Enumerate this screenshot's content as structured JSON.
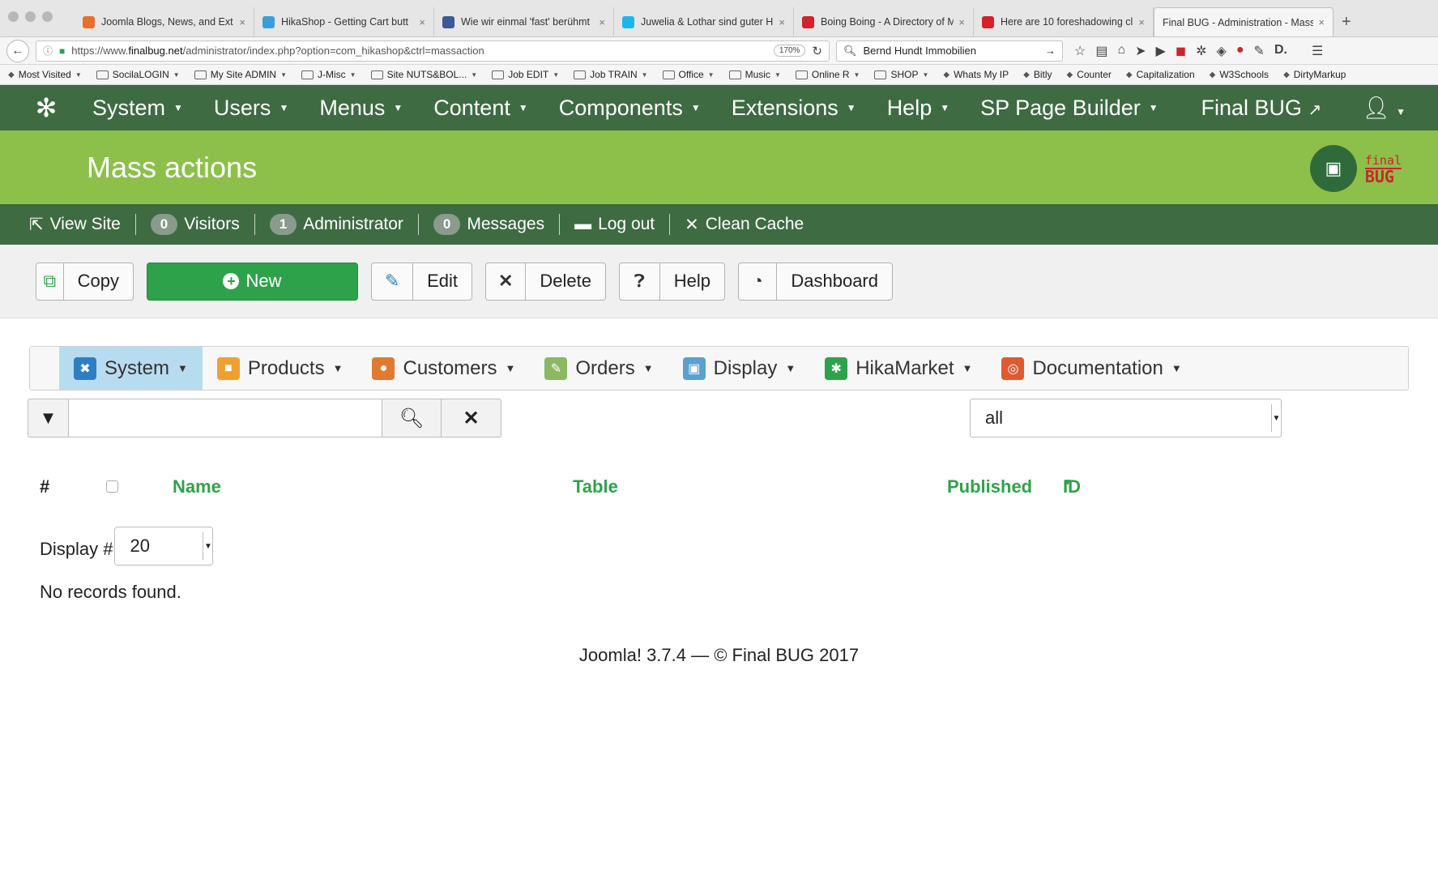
{
  "browser": {
    "tabs": [
      {
        "title": "Joomla Blogs, News, and Ext",
        "color": "#e8702a"
      },
      {
        "title": "HikaShop - Getting Cart butt",
        "color": "#3a9fd8"
      },
      {
        "title": "Wie wir einmal 'fast' berühmt",
        "color": "#3b5998"
      },
      {
        "title": "Juwelia & Lothar sind guter H",
        "color": "#1ab7ea"
      },
      {
        "title": "Boing Boing - A Directory of M",
        "color": "#d4212b"
      },
      {
        "title": "Here are 10 foreshadowing cl",
        "color": "#d4212b"
      },
      {
        "title": "Final BUG - Administration - Mass",
        "color": "#ffffff",
        "active": true
      }
    ],
    "new_tab": "+",
    "url_prefix": "https://www.",
    "url_domain": "finalbug.net",
    "url_rest": "/administrator/index.php?option=com_hikashop&ctrl=massaction",
    "zoom": "170%",
    "search_value": "Bernd Hundt Immobilien",
    "bookmarks": [
      {
        "label": "Most Visited",
        "folder": false,
        "caret": true
      },
      {
        "label": "SocilaLOGIN",
        "folder": true,
        "caret": true
      },
      {
        "label": "My Site ADMIN",
        "folder": true,
        "caret": true
      },
      {
        "label": "J-Misc",
        "folder": true,
        "caret": true
      },
      {
        "label": "Site NUTS&BOL...",
        "folder": true,
        "caret": true
      },
      {
        "label": "Job EDIT",
        "folder": true,
        "caret": true
      },
      {
        "label": "Job TRAIN",
        "folder": true,
        "caret": true
      },
      {
        "label": "Office",
        "folder": true,
        "caret": true
      },
      {
        "label": "Music",
        "folder": true,
        "caret": true
      },
      {
        "label": "Online R",
        "folder": true,
        "caret": true
      },
      {
        "label": "SHOP",
        "folder": true,
        "caret": true
      },
      {
        "label": "Whats My IP",
        "folder": false,
        "caret": false
      },
      {
        "label": "Bitly",
        "folder": false,
        "caret": false
      },
      {
        "label": "Counter",
        "folder": false,
        "caret": false
      },
      {
        "label": "Capitalization",
        "folder": false,
        "caret": false
      },
      {
        "label": "W3Schools",
        "folder": false,
        "caret": false
      },
      {
        "label": "DirtyMarkup",
        "folder": false,
        "caret": false
      }
    ]
  },
  "joomla": {
    "menu": [
      "System",
      "Users",
      "Menus",
      "Content",
      "Components",
      "Extensions",
      "Help",
      "SP Page Builder"
    ],
    "site_link": "Final BUG",
    "page_title": "Mass actions",
    "brand_small": "final",
    "brand_big": "BUG",
    "status": {
      "view_site": "View Site",
      "visitors_count": "0",
      "visitors_label": "Visitors",
      "admin_count": "1",
      "admin_label": "Administrator",
      "messages_count": "0",
      "messages_label": "Messages",
      "logout": "Log out",
      "clean_cache": "Clean Cache"
    },
    "toolbar": {
      "copy": "Copy",
      "new": "New",
      "edit": "Edit",
      "delete": "Delete",
      "help": "Help",
      "dashboard": "Dashboard"
    }
  },
  "hikashop": {
    "menu": [
      {
        "label": "System",
        "icon": "wrench-icon",
        "color": "#2e7fc2",
        "active": true
      },
      {
        "label": "Products",
        "icon": "box-icon",
        "color": "#f0a030"
      },
      {
        "label": "Customers",
        "icon": "users-icon",
        "color": "#e07a30"
      },
      {
        "label": "Orders",
        "icon": "orders-icon",
        "color": "#8bb860"
      },
      {
        "label": "Display",
        "icon": "display-icon",
        "color": "#5aa0d0"
      },
      {
        "label": "HikaMarket",
        "icon": "market-icon",
        "color": "#2ea24b"
      },
      {
        "label": "Documentation",
        "icon": "lifebuoy-icon",
        "color": "#e05a30"
      }
    ],
    "filter": {
      "search_value": "",
      "state_select": "all"
    },
    "table": {
      "hash": "#",
      "name": "Name",
      "table": "Table",
      "published": "Published",
      "id": "ID"
    },
    "display_label": "Display #",
    "display_value": "20",
    "no_records": "No records found.",
    "footer": "Joomla! 3.7.4  —  © Final BUG 2017"
  }
}
